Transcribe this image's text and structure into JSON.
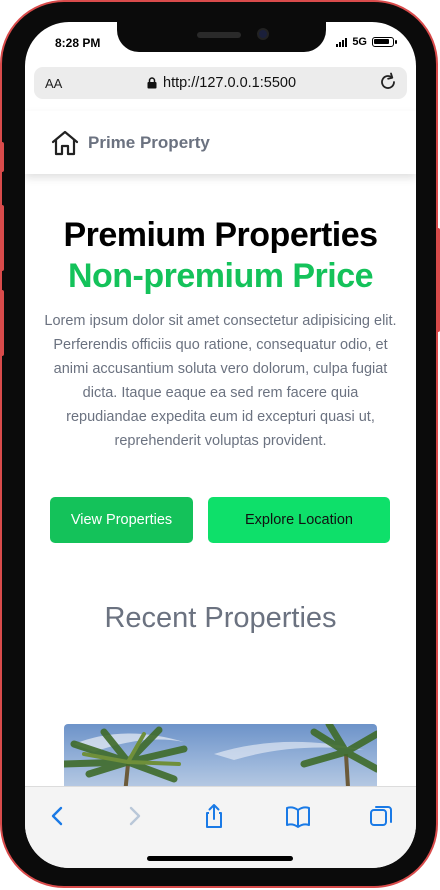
{
  "status_bar": {
    "time": "8:28 PM",
    "network": "5G"
  },
  "browser": {
    "text_size_label": "AA",
    "url": "http://127.0.0.1:5500"
  },
  "navbar": {
    "brand": "Prime Property"
  },
  "hero": {
    "title": "Premium Properties",
    "subtitle": "Non-premium Price",
    "description": "Lorem ipsum dolor sit amet consectetur adipisicing elit. Perferendis officiis quo ratione, consequatur odio, et animi accusantium soluta vero dolorum, culpa fugiat dicta. Itaque eaque ea sed rem facere quia repudiandae expedita eum id excepturi quasi ut, reprehenderit voluptas provident.",
    "primary_button": "View Properties",
    "secondary_button": "Explore Location"
  },
  "recent": {
    "title": "Recent Properties"
  },
  "colors": {
    "accent_green": "#14c25a",
    "secondary_green": "#0ee06a",
    "phone_frame": "#d94b4b",
    "muted_text": "#6b7280"
  },
  "icons": {
    "brand": "house-icon",
    "lock": "lock-icon",
    "reload": "reload-icon",
    "back": "chevron-left-icon",
    "forward": "chevron-right-icon",
    "share": "share-icon",
    "bookmarks": "book-icon",
    "tabs": "tabs-icon"
  }
}
